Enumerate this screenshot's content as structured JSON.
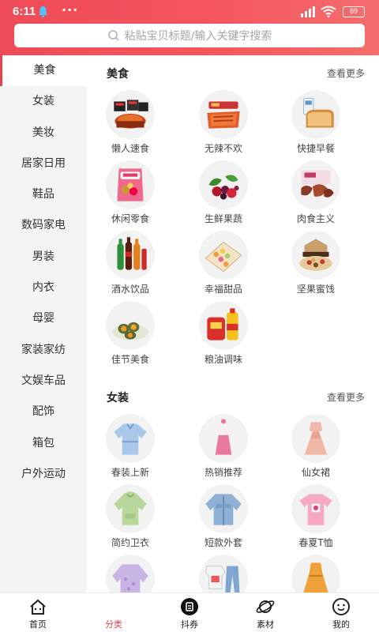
{
  "status_bar": {
    "time": "6:11",
    "dots": "···",
    "battery": "89"
  },
  "search": {
    "placeholder": "粘贴宝贝标题/输入关键字搜索"
  },
  "sidebar": {
    "active_index": 0,
    "items": [
      "美食",
      "女装",
      "美妆",
      "居家日用",
      "鞋品",
      "数码家电",
      "男装",
      "内衣",
      "母婴",
      "家装家纺",
      "文娱车品",
      "配饰",
      "箱包",
      "户外运动"
    ]
  },
  "sections": [
    {
      "title": "美食",
      "more": "查看更多",
      "items": [
        {
          "label": "懒人速食",
          "icon": "instant-noodles-icon"
        },
        {
          "label": "无辣不欢",
          "icon": "spicy-snacks-icon"
        },
        {
          "label": "快捷早餐",
          "icon": "bread-milk-icon"
        },
        {
          "label": "休闲零食",
          "icon": "chips-bag-icon"
        },
        {
          "label": "生鲜果蔬",
          "icon": "fresh-fruit-icon"
        },
        {
          "label": "肉食主义",
          "icon": "meat-snack-icon"
        },
        {
          "label": "酒水饮品",
          "icon": "drink-bottles-icon"
        },
        {
          "label": "幸福甜品",
          "icon": "dessert-box-icon"
        },
        {
          "label": "坚果蜜饯",
          "icon": "nut-gift-box-icon"
        },
        {
          "label": "佳节美食",
          "icon": "salted-egg-icon"
        },
        {
          "label": "粮油调味",
          "icon": "rice-oil-icon"
        }
      ]
    },
    {
      "title": "女装",
      "more": "查看更多",
      "items": [
        {
          "label": "春装上新",
          "icon": "blue-blouse-icon"
        },
        {
          "label": "热销推荐",
          "icon": "pink-outfit-icon"
        },
        {
          "label": "仙女裙",
          "icon": "pink-dress-icon"
        },
        {
          "label": "简约卫衣",
          "icon": "green-hoodie-icon"
        },
        {
          "label": "短款外套",
          "icon": "denim-jacket-icon"
        },
        {
          "label": "春夏T恤",
          "icon": "pink-tshirt-icon"
        },
        {
          "label": "",
          "icon": "lilac-top-icon"
        },
        {
          "label": "",
          "icon": "tee-jeans-icon"
        },
        {
          "label": "",
          "icon": "orange-dress-icon"
        }
      ]
    }
  ],
  "tabbar": {
    "active_index": 1,
    "items": [
      {
        "label": "首页",
        "icon": "home-icon"
      },
      {
        "label": "分类",
        "icon": "category-icon"
      },
      {
        "label": "抖券",
        "icon": "coupon-icon"
      },
      {
        "label": "素材",
        "icon": "planet-icon"
      },
      {
        "label": "我的",
        "icon": "smiley-icon"
      }
    ]
  },
  "colors": {
    "accent": "#e8434f",
    "header_start": "#ef4a57",
    "header_end": "#f56d6d",
    "sidebar_bg": "#f4f4f4"
  }
}
